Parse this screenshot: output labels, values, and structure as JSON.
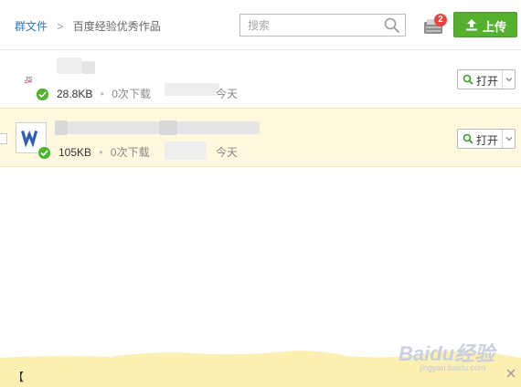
{
  "breadcrumb": {
    "root": "群文件",
    "separator": ">",
    "current": "百度经验优秀作品"
  },
  "search": {
    "placeholder": "搜索",
    "value": ""
  },
  "inbox": {
    "badge_count": "2"
  },
  "upload": {
    "label": "上传"
  },
  "files": [
    {
      "size": "28.8KB",
      "downloads": "0次下载",
      "time": "今天",
      "open_label": "打开"
    },
    {
      "size": "105KB",
      "downloads": "0次下载",
      "time": "今天",
      "open_label": "打开"
    }
  ],
  "bottom_bar": {
    "text": "【",
    "watermark_main": "Baidu经验",
    "watermark_sub": "jingyan.baidu.com"
  },
  "colors": {
    "accent_green": "#55b12d",
    "link_blue": "#2b74c9",
    "badge_red": "#e8443a",
    "selected_row": "#fff8df",
    "notice_bar": "#fbefb2"
  }
}
